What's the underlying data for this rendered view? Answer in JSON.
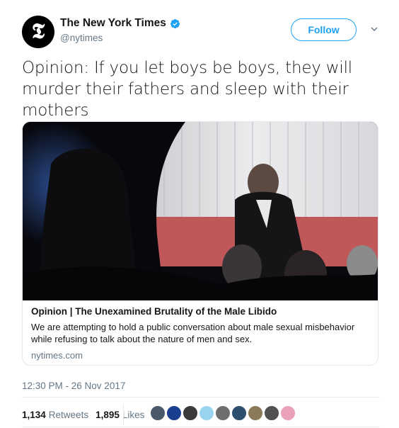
{
  "tweet": {
    "author": {
      "display_name": "The New York Times",
      "handle": "@nytimes",
      "verified": true,
      "avatar_icon": "nyt-logo-icon"
    },
    "follow_label": "Follow",
    "text": "Opinion: If you let boys be boys, they will murder their fathers and sleep with their mothers",
    "card": {
      "title": "Opinion | The Unexamined Brutality of the Male Libido",
      "description": "We are attempting to hold a public conversation about male sexual misbehavior while refusing to talk about the nature of men and sex.",
      "domain": "nytimes.com"
    },
    "timestamp": "12:30 PM - 26 Nov 2017",
    "stats": {
      "retweets_count": "1,134",
      "retweets_label": "Retweets",
      "likes_count": "1,895",
      "likes_label": "Likes"
    },
    "liker_avatar_colors": [
      "#4a5a6a",
      "#1b3f8f",
      "#3a3a3a",
      "#9ad3f0",
      "#6e6e6e",
      "#2f4f6f",
      "#8a7a5a",
      "#505050",
      "#e9a0b8"
    ]
  },
  "colors": {
    "accent": "#1da1f2",
    "secondary_text": "#657786"
  }
}
